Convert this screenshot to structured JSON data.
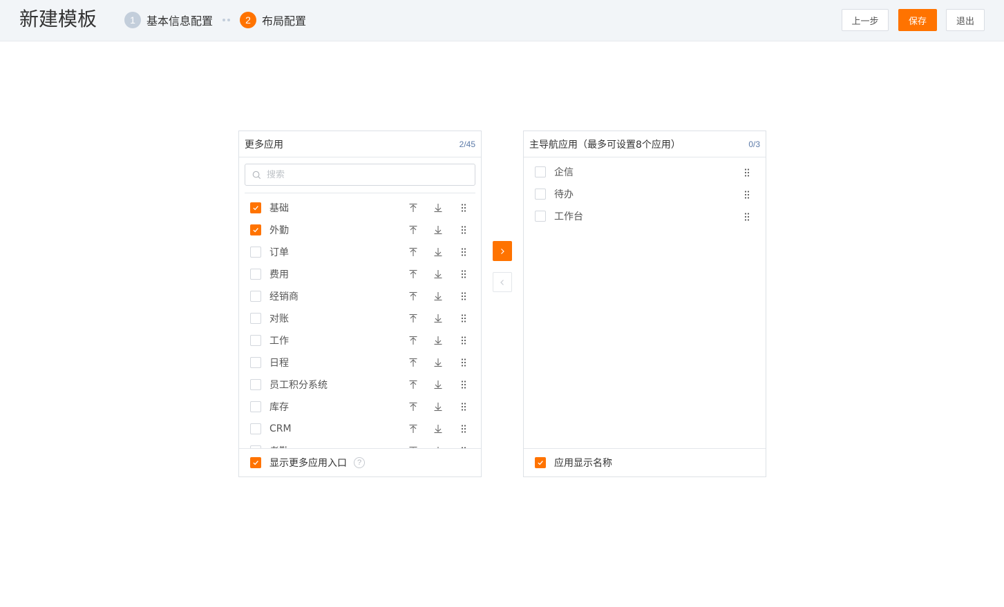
{
  "header": {
    "title": "新建模板",
    "steps": [
      {
        "num": "1",
        "label": "基本信息配置"
      },
      {
        "num": "2",
        "label": "布局配置"
      }
    ],
    "prev_label": "上一步",
    "save_label": "保存",
    "exit_label": "退出"
  },
  "left_panel": {
    "title": "更多应用",
    "count": "2/45",
    "search_placeholder": "搜索",
    "items": [
      {
        "label": "基础",
        "checked": true
      },
      {
        "label": "外勤",
        "checked": true
      },
      {
        "label": "订单",
        "checked": false
      },
      {
        "label": "费用",
        "checked": false
      },
      {
        "label": "经销商",
        "checked": false
      },
      {
        "label": "对账",
        "checked": false
      },
      {
        "label": "工作",
        "checked": false
      },
      {
        "label": "日程",
        "checked": false
      },
      {
        "label": "员工积分系统",
        "checked": false
      },
      {
        "label": "库存",
        "checked": false
      },
      {
        "label": "CRM",
        "checked": false
      },
      {
        "label": "考勤",
        "checked": false
      }
    ],
    "footer_label": "显示更多应用入口",
    "footer_checked": true,
    "help_glyph": "?"
  },
  "right_panel": {
    "title": "主导航应用（最多可设置8个应用）",
    "count": "0/3",
    "items": [
      {
        "label": "企信",
        "checked": false
      },
      {
        "label": "待办",
        "checked": false
      },
      {
        "label": "工作台",
        "checked": false
      }
    ],
    "footer_label": "应用显示名称",
    "footer_checked": true
  },
  "colors": {
    "accent": "#ff7300",
    "header_bg": "#f2f5f8",
    "step_done": "#c3cedb",
    "count_text": "#5b7aa8"
  },
  "icons": {
    "search": "search-icon",
    "move_top": "move-to-top-icon",
    "move_bottom": "move-to-bottom-icon",
    "drag": "drag-handle-icon",
    "transfer_right": "chevron-right-icon",
    "transfer_left": "chevron-left-icon",
    "check": "check-icon"
  }
}
